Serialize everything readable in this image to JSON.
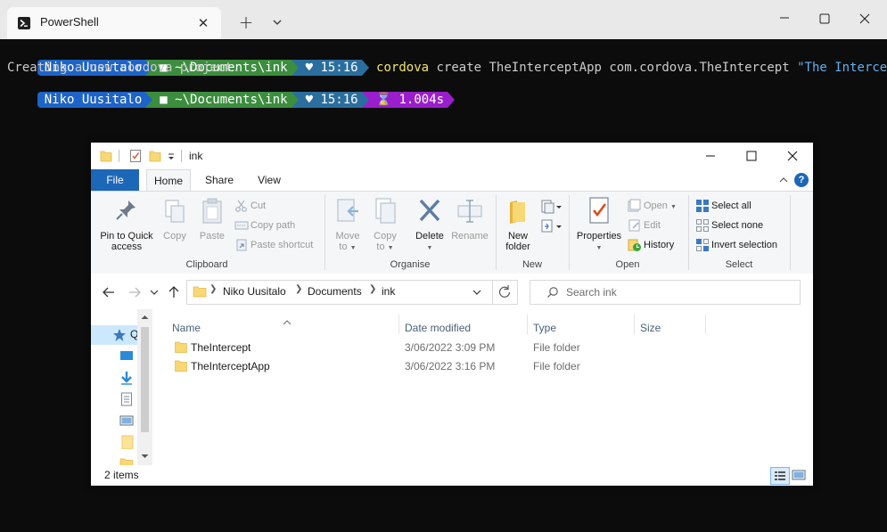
{
  "terminal": {
    "tab_title": "PowerShell",
    "prompt": {
      "user": "Niko Uusitalo",
      "path": "~\\Documents\\ink",
      "time": "15:16",
      "exec_time": "1.004s"
    },
    "command": {
      "name": "cordova",
      "args": "create TheInterceptApp com.cordova.TheIntercept",
      "string_arg": "\"The Intercept\""
    },
    "output": "Creating a new cordova project."
  },
  "explorer": {
    "title": "ink",
    "tabs": {
      "file": "File",
      "home": "Home",
      "share": "Share",
      "view": "View"
    },
    "help": "?",
    "ribbon": {
      "clipboard": {
        "label": "Clipboard",
        "pin_line1": "Pin to Quick",
        "pin_line2": "access",
        "copy": "Copy",
        "paste": "Paste",
        "cut": "Cut",
        "copy_path": "Copy path",
        "paste_shortcut": "Paste shortcut"
      },
      "organise": {
        "label": "Organise",
        "move_to_line1": "Move",
        "move_to_line2": "to",
        "copy_to_line1": "Copy",
        "copy_to_line2": "to",
        "delete": "Delete",
        "rename": "Rename"
      },
      "new": {
        "label": "New",
        "new_folder_line1": "New",
        "new_folder_line2": "folder"
      },
      "open": {
        "label": "Open",
        "properties": "Properties",
        "open": "Open",
        "edit": "Edit",
        "history": "History"
      },
      "select": {
        "label": "Select",
        "select_all": "Select all",
        "select_none": "Select none",
        "invert": "Invert selection"
      }
    },
    "address": {
      "crumbs": [
        "Niko Uusitalo",
        "Documents",
        "ink"
      ]
    },
    "search": {
      "placeholder": "Search ink"
    },
    "nav_pane": {
      "quick_access_label": "Q"
    },
    "columns": {
      "name": "Name",
      "date": "Date modified",
      "type": "Type",
      "size": "Size"
    },
    "files": [
      {
        "name": "TheIntercept",
        "date": "3/06/2022 3:09 PM",
        "type": "File folder",
        "size": ""
      },
      {
        "name": "TheInterceptApp",
        "date": "3/06/2022 3:16 PM",
        "type": "File folder",
        "size": ""
      }
    ],
    "status": {
      "item_count": "2 items"
    }
  },
  "colors": {
    "seg_user": "#1e64c8",
    "seg_path": "#3c8e3e",
    "seg_time": "#2a6e9e",
    "seg_exec": "#9a1ecc",
    "accent": "#1c67b8"
  }
}
